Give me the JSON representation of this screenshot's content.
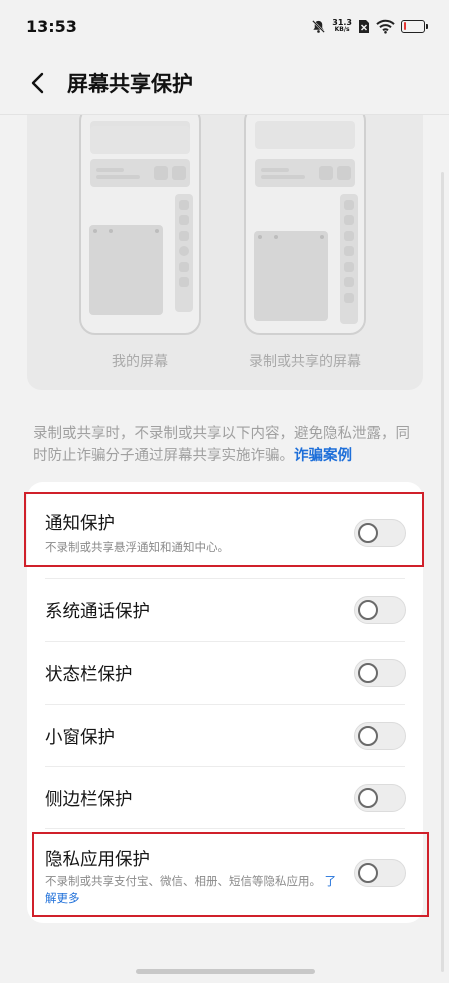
{
  "status_bar": {
    "time": "13:53",
    "net_speed_value": "31.3",
    "net_speed_unit": "KB/s",
    "icons": [
      "bell-off-icon",
      "sim-card-icon",
      "wifi-icon",
      "battery-icon"
    ],
    "battery_level": 0.15,
    "battery_color": "#e53935"
  },
  "header": {
    "title": "屏幕共享保护",
    "back_icon": "chevron-left-icon"
  },
  "preview": {
    "left_caption": "我的屏幕",
    "right_caption": "录制或共享的屏幕"
  },
  "description": {
    "text": "录制或共享时，不录制或共享以下内容，避免隐私泄露，同时防止诈骗分子通过屏幕共享实施诈骗。",
    "link": "诈骗案例",
    "link_color": "#1e6fd9"
  },
  "settings": {
    "items": [
      {
        "title": "通知保护",
        "subtitle": "不录制或共享悬浮通知和通知中心。",
        "enabled": false
      },
      {
        "title": "系统通话保护",
        "enabled": false
      },
      {
        "title": "状态栏保护",
        "enabled": false
      },
      {
        "title": "小窗保护",
        "enabled": false
      },
      {
        "title": "侧边栏保护",
        "enabled": false
      },
      {
        "title": "隐私应用保护",
        "subtitle": "不录制或共享支付宝、微信、相册、短信等隐私应用。",
        "subtitle_link": "了解更多",
        "enabled": false
      }
    ],
    "highlight_color": "#d0202a"
  }
}
